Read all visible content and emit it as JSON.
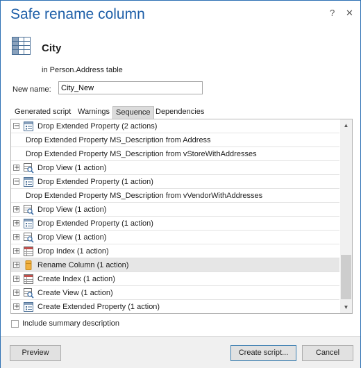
{
  "window": {
    "title": "Safe rename column",
    "help_glyph": "?",
    "close_glyph": "✕"
  },
  "object": {
    "name": "City",
    "location": "in Person.Address table",
    "icon": "table-icon"
  },
  "new_name": {
    "label": "New name:",
    "value": "City_New"
  },
  "tabs": [
    {
      "label": "Generated script",
      "active": false
    },
    {
      "label": "Warnings",
      "active": false
    },
    {
      "label": "Sequence",
      "active": true
    },
    {
      "label": "Dependencies",
      "active": false
    }
  ],
  "sequence": [
    {
      "label": "Drop Extended Property (2 actions)",
      "expander": "−",
      "icon": "extended-property-icon"
    },
    {
      "label": "Drop Extended Property MS_Description from Address"
    },
    {
      "label": "Drop Extended Property MS_Description from vStoreWithAddresses"
    },
    {
      "label": "Drop View (1 action)",
      "expander": "+",
      "icon": "view-icon"
    },
    {
      "label": "Drop Extended Property (1 action)",
      "expander": "−",
      "icon": "extended-property-icon"
    },
    {
      "label": "Drop Extended Property MS_Description from vVendorWithAddresses"
    },
    {
      "label": "Drop View (1 action)",
      "expander": "+",
      "icon": "view-icon"
    },
    {
      "label": "Drop Extended Property (1 action)",
      "expander": "+",
      "icon": "extended-property-icon"
    },
    {
      "label": "Drop View (1 action)",
      "expander": "+",
      "icon": "view-icon"
    },
    {
      "label": "Drop Index (1 action)",
      "expander": "+",
      "icon": "index-icon"
    },
    {
      "label": "Rename Column (1 action)",
      "expander": "+",
      "icon": "column-icon",
      "selected": true
    },
    {
      "label": "Create Index (1 action)",
      "expander": "+",
      "icon": "index-icon"
    },
    {
      "label": "Create View (1 action)",
      "expander": "+",
      "icon": "view-icon"
    },
    {
      "label": "Create Extended Property (1 action)",
      "expander": "+",
      "icon": "extended-property-icon"
    }
  ],
  "summary_checkbox": {
    "label": "Include summary description",
    "checked": false
  },
  "buttons": {
    "preview": "Preview",
    "create_script": "Create script...",
    "cancel": "Cancel"
  },
  "colors": {
    "title": "#1e5fa8",
    "window_border": "#2b6fb3",
    "selected_row": "#e6e6e6",
    "folder": "#f0b040"
  }
}
